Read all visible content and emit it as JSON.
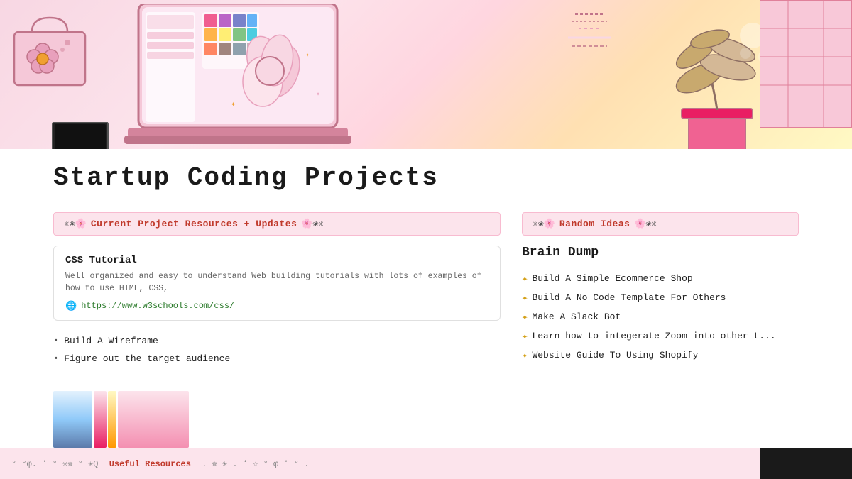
{
  "hero": {
    "alt": "Coding workspace illustration with laptop and plants"
  },
  "page": {
    "title": "Startup Coding Projects"
  },
  "left_column": {
    "section_header": {
      "deco_left": "✳❀🌸",
      "title": "Current Project Resources + Updates",
      "deco_right": "🌸❀✳"
    },
    "resource_card": {
      "title": "CSS Tutorial",
      "description": "Well organized and easy to understand Web building tutorials with lots of examples of how to use HTML, CSS,",
      "link_text": "https://www.w3schools.com/css/",
      "link_icon": "🌐"
    },
    "bullet_items": [
      "Build A Wireframe",
      "Figure out the target audience"
    ]
  },
  "right_column": {
    "section_header": {
      "deco_left": "✳❀🌸",
      "title": "Random Ideas",
      "deco_right": "🌸❀✳"
    },
    "brain_dump_title": "Brain Dump",
    "ideas": [
      "Build A Simple Ecommerce Shop",
      "Build A No Code Template For Others",
      "Make A Slack Bot",
      "Learn how to integerate Zoom into other t...",
      "Website Guide To Using Shopify"
    ]
  },
  "bottom_bar": {
    "text_parts": [
      "°",
      "°φ.",
      "ʻ",
      "°",
      "✳✵",
      "°",
      "✳Q",
      "Useful Resources",
      ".",
      "✵",
      "✳",
      ".",
      "ʻ",
      "☆",
      "°",
      "φ",
      "ʻ",
      "°",
      "."
    ]
  },
  "icons": {
    "sparkle": "✦",
    "bullet": "▪",
    "link": "🌐"
  }
}
